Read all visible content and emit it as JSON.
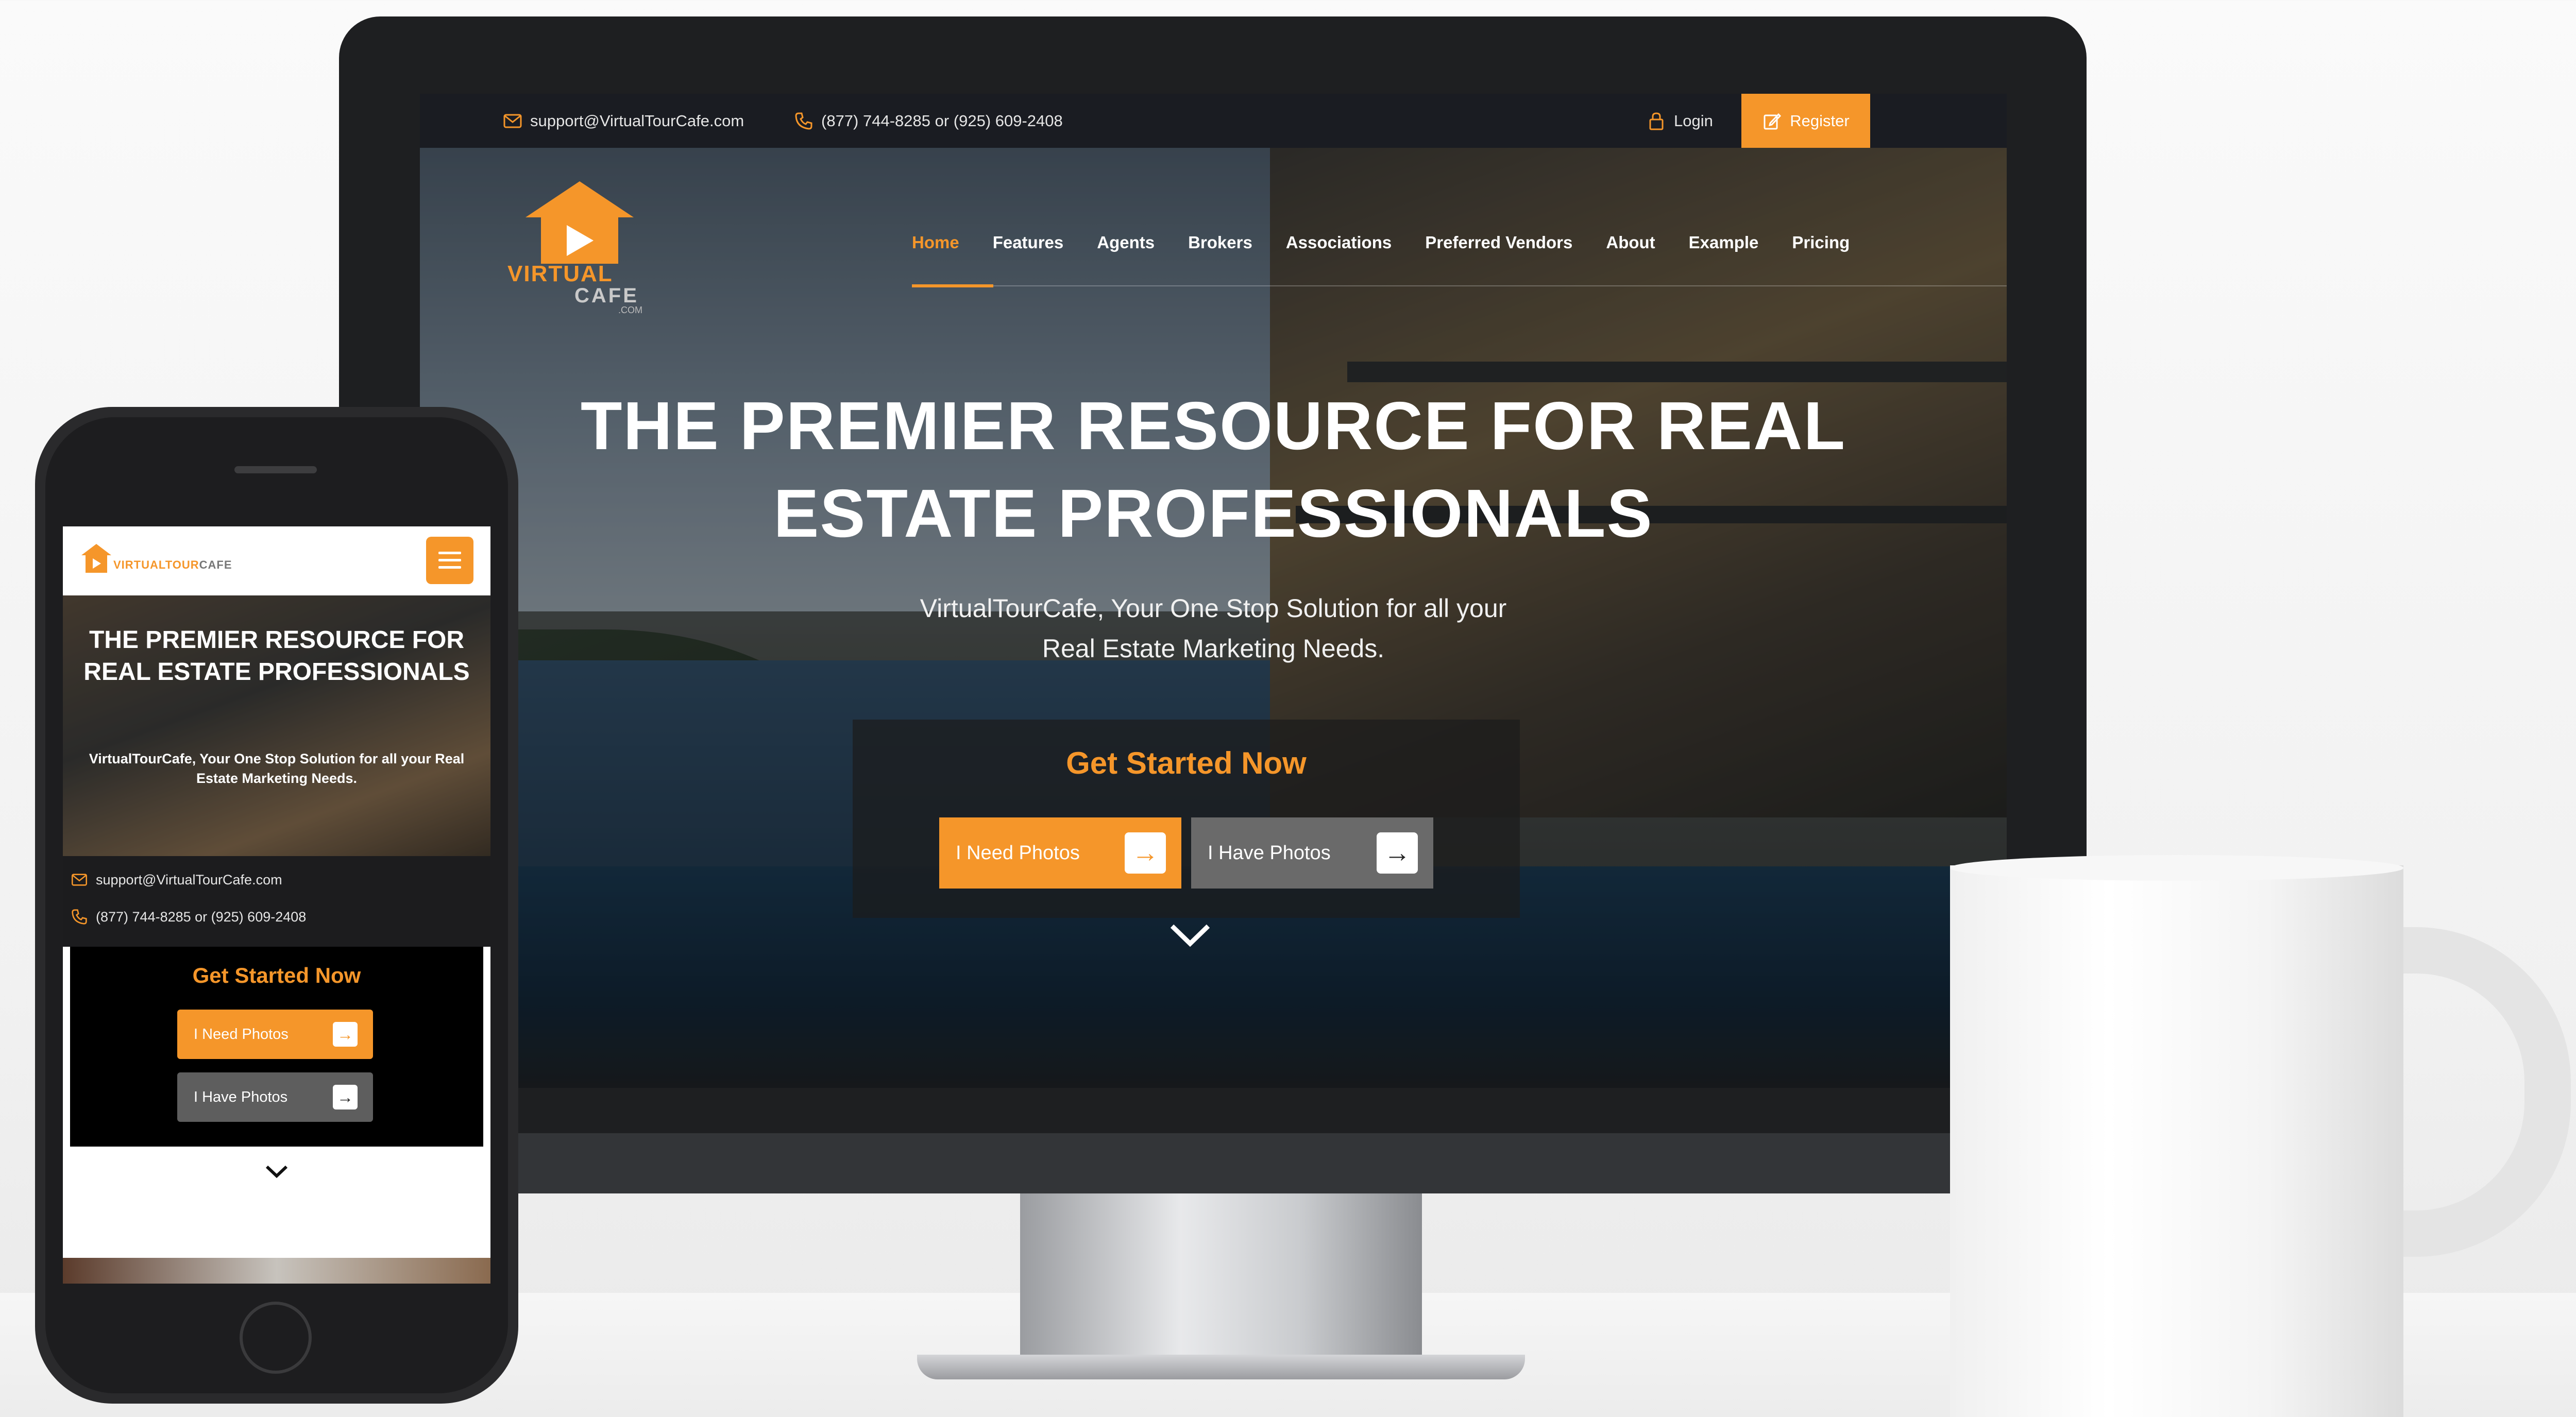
{
  "desktop": {
    "topbar": {
      "email": "support@VirtualTourCafe.com",
      "phone": "(877) 744-8285 or (925) 609-2408",
      "login_label": "Login",
      "register_label": "Register"
    },
    "logo": {
      "line1": "VIRTUAL",
      "line2": "CAFE",
      "suffix": ".COM"
    },
    "nav": {
      "items": [
        "Home",
        "Features",
        "Agents",
        "Brokers",
        "Associations",
        "Preferred Vendors",
        "About",
        "Example",
        "Pricing"
      ],
      "active": "Home"
    },
    "hero": {
      "title_line1": "THE PREMIER RESOURCE FOR REAL",
      "title_line2": "ESTATE PROFESSIONALS",
      "subtitle_line1": "VirtualTourCafe, Your One Stop Solution for all your",
      "subtitle_line2": "Real Estate Marketing Needs."
    },
    "cta": {
      "title": "Get Started Now",
      "need_photos": "I Need Photos",
      "have_photos": "I Have Photos"
    }
  },
  "mobile": {
    "logo_text": "VIRTUALTOUR",
    "logo_text_accent": "CAFE",
    "hero": {
      "title": "THE PREMIER RESOURCE FOR REAL ESTATE PROFESSIONALS",
      "subtitle": "VirtualTourCafe, Your One Stop Solution for all your Real Estate Marketing Needs."
    },
    "email": "support@VirtualTourCafe.com",
    "phone": "(877) 744-8285 or (925) 609-2408",
    "cta": {
      "title": "Get Started Now",
      "need_photos": "I Need Photos",
      "have_photos": "I Have Photos"
    }
  },
  "icons": {
    "email": "envelope-icon",
    "phone": "phone-icon",
    "login": "lock-icon",
    "register": "edit-icon",
    "arrow": "arrow-right-icon",
    "scroll": "chevron-down-icon",
    "menu": "hamburger-icon"
  },
  "colors": {
    "accent": "#f5962a",
    "topbar": "#1a1c22",
    "cta_box": "#1c1c1c",
    "secondary_button": "#6a6a6a"
  }
}
